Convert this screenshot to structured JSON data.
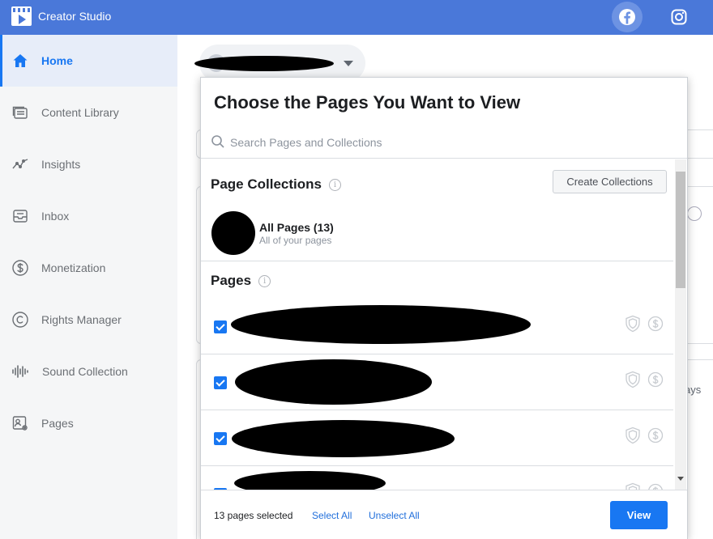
{
  "app": {
    "title": "Creator Studio",
    "facebook_icon": "facebook-icon",
    "instagram_icon": "instagram-icon",
    "accent": "#4a78d9"
  },
  "sidebar": {
    "items": [
      {
        "label": "Home",
        "icon": "home-icon",
        "active": true
      },
      {
        "label": "Content Library",
        "icon": "content-library-icon"
      },
      {
        "label": "Insights",
        "icon": "insights-icon"
      },
      {
        "label": "Inbox",
        "icon": "inbox-icon"
      },
      {
        "label": "Monetization",
        "icon": "dollar-icon"
      },
      {
        "label": "Rights Manager",
        "icon": "copyright-icon"
      },
      {
        "label": "Sound Collection",
        "icon": "sound-wave-icon"
      },
      {
        "label": "Pages",
        "icon": "pages-icon"
      }
    ]
  },
  "background": {
    "partial_text": "ays"
  },
  "modal": {
    "title": "Choose the Pages You Want to View",
    "search_placeholder": "Search Pages and Collections",
    "collections": {
      "heading": "Page Collections",
      "create_label": "Create Collections",
      "all_pages_title": "All Pages (13)",
      "all_pages_subtitle": "All of your pages"
    },
    "pages": {
      "heading": "Pages",
      "rows": [
        {
          "checked": true
        },
        {
          "checked": true
        },
        {
          "checked": true
        },
        {
          "checked": true
        }
      ]
    },
    "footer": {
      "selected_text": "13 pages selected",
      "select_all": "Select All",
      "unselect_all": "Unselect All",
      "view_label": "View"
    },
    "primary_color": "#1877f2"
  }
}
